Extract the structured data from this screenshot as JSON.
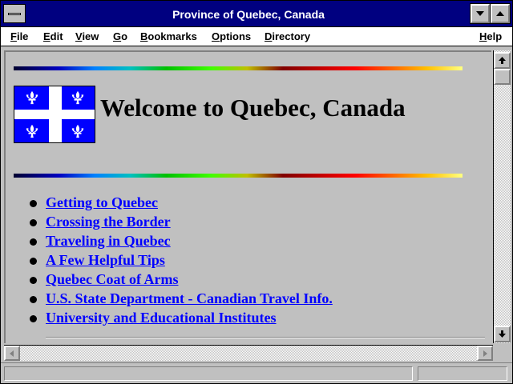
{
  "window": {
    "title": "Province of Quebec, Canada"
  },
  "menu": {
    "items": [
      {
        "underline": "F",
        "rest": "ile"
      },
      {
        "underline": "E",
        "rest": "dit"
      },
      {
        "underline": "V",
        "rest": "iew"
      },
      {
        "underline": "G",
        "rest": "o"
      },
      {
        "underline": "B",
        "rest": "ookmarks"
      },
      {
        "underline": "O",
        "rest": "ptions"
      },
      {
        "underline": "D",
        "rest": "irectory"
      },
      {
        "underline": "H",
        "rest": "elp"
      }
    ]
  },
  "page": {
    "heading": "Welcome to Quebec, Canada",
    "links": [
      "Getting to Quebec",
      "Crossing the Border",
      "Traveling in Quebec",
      "A Few Helpful Tips",
      "Quebec Coat of Arms",
      "U.S. State Department - Canadian Travel Info.",
      "University and Educational Institutes"
    ]
  },
  "status": {
    "text": ""
  },
  "icons": {
    "system_menu": "system-menu-icon",
    "minimize": "minimize-arrow-icon",
    "maximize": "maximize-arrow-icon",
    "scroll_up": "arrow-up-icon",
    "scroll_down": "arrow-down-icon",
    "scroll_left": "arrow-left-icon",
    "scroll_right": "arrow-right-icon",
    "flag": "quebec-flag-icon",
    "fleur_de_lis": "fleur-de-lis-icon"
  },
  "colors": {
    "title_bar": "#000080",
    "link": "#0000ff",
    "flag_blue": "#0000ff",
    "background": "#c0c0c0"
  }
}
